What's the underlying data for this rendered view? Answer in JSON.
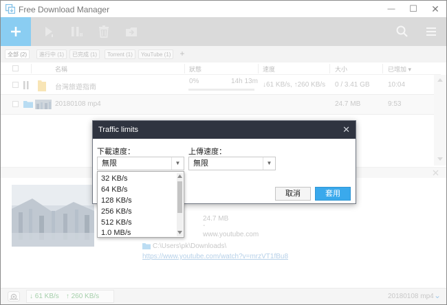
{
  "window": {
    "title": "Free Download Manager",
    "minimize_glyph": "—",
    "maximize_glyph": "☐",
    "close_glyph": "✕"
  },
  "toolbar": {
    "icons": [
      "add-icon",
      "play-icon",
      "pause-icon",
      "trash-icon",
      "move-icon",
      "search-icon",
      "menu-icon"
    ]
  },
  "filters": {
    "tabs": [
      "全部 (2)",
      "進行中 (1)",
      "已完成 (1)",
      "Torrent (1)",
      "YouTube (1)"
    ],
    "add_glyph": "+"
  },
  "table": {
    "columns": {
      "name": "名稱",
      "status": "狀態",
      "speed": "速度",
      "size": "大小",
      "added": "已增加 ▾"
    },
    "rows": [
      {
        "name": "台灣旅遊指南",
        "status": "0%",
        "eta": "14h 13m",
        "speed": "↓61 KB/s, ↑260 KB/s",
        "size": "0 / 3.41 GB",
        "added": "10:04",
        "progress": 0.0
      },
      {
        "name": "20180108 mp4",
        "status": "",
        "eta": "",
        "speed": "",
        "size": "24.7 MB",
        "added": "9:53"
      }
    ]
  },
  "details": {
    "size": "24.7 MB",
    "dash": "-",
    "source": "www.youtube.com",
    "path": "C:\\Users\\pk\\Downloads\\",
    "url": "https://www.youtube.com/watch?v=mrzVT1fBu8"
  },
  "status_bar": {
    "download_speed": "↓ 61 KB/s",
    "upload_speed": "↑ 260 KB/s",
    "selected_file": "20180108 mp4",
    "chevron": "⌄"
  },
  "dialog": {
    "title": "Traffic limits",
    "close_glyph": "✕",
    "download_label": "下載速度：",
    "upload_label": "上傳速度：",
    "download_value": "無限",
    "upload_value": "無限",
    "cancel_label": "取消",
    "apply_label": "套用"
  },
  "dropdown": {
    "options": [
      "32 KB/s",
      "64 KB/s",
      "128 KB/s",
      "256 KB/s",
      "512 KB/s",
      "1.0 MB/s"
    ]
  },
  "colors": {
    "accent": "#2aa5e8",
    "toolbar": "#bcbcbc",
    "dialog_title": "#2f3440",
    "download_green": "#4caf50",
    "upload_green": "#3aa04a"
  }
}
